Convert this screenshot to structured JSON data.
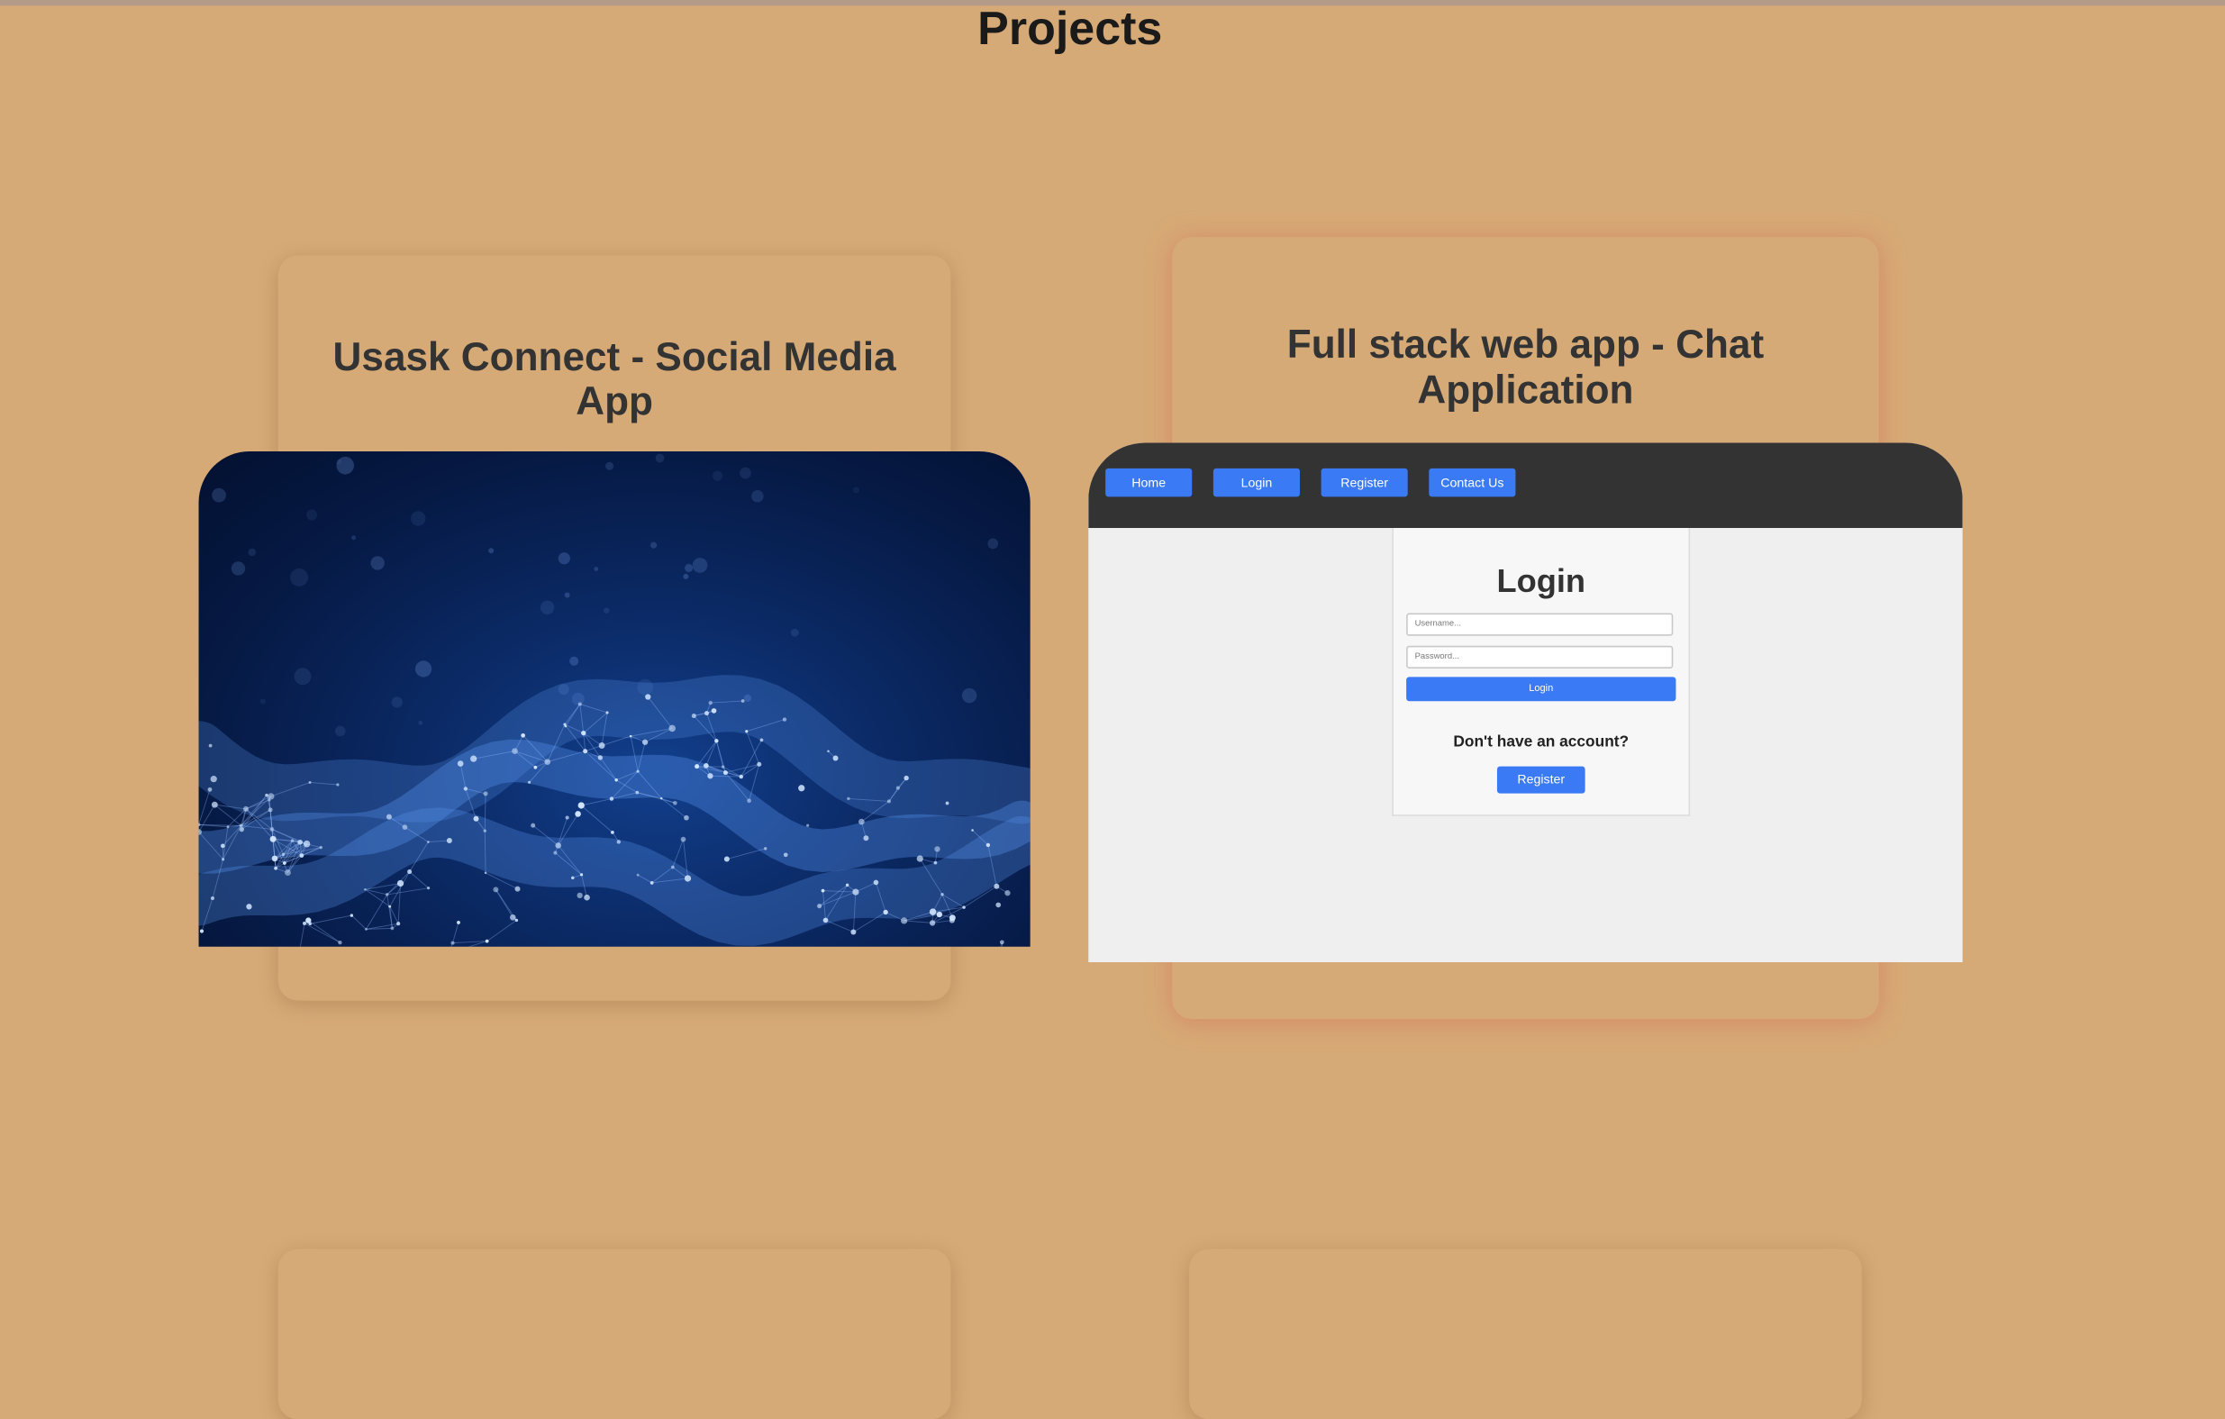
{
  "page": {
    "title": "Projects",
    "background": "#d6aa76"
  },
  "projects": [
    {
      "title": "Usask Connect - Social Media App",
      "title_lines": [
        "Usask Connect - Social Media",
        "App"
      ],
      "preview_icon": "network-wave-image"
    },
    {
      "title": "Full stack web app - Chat Application",
      "title_lines": [
        "Full stack web app - Chat",
        "Application"
      ],
      "preview": {
        "nav": [
          "Home",
          "Login",
          "Register",
          "Contact Us"
        ],
        "login_heading": "Login",
        "username_placeholder": "Username...",
        "password_placeholder": "Password...",
        "login_button": "Login",
        "no_account_text": "Don't have an account?",
        "register_button": "Register",
        "accent_color": "#3a7af5",
        "nav_color": "#333333"
      }
    }
  ]
}
